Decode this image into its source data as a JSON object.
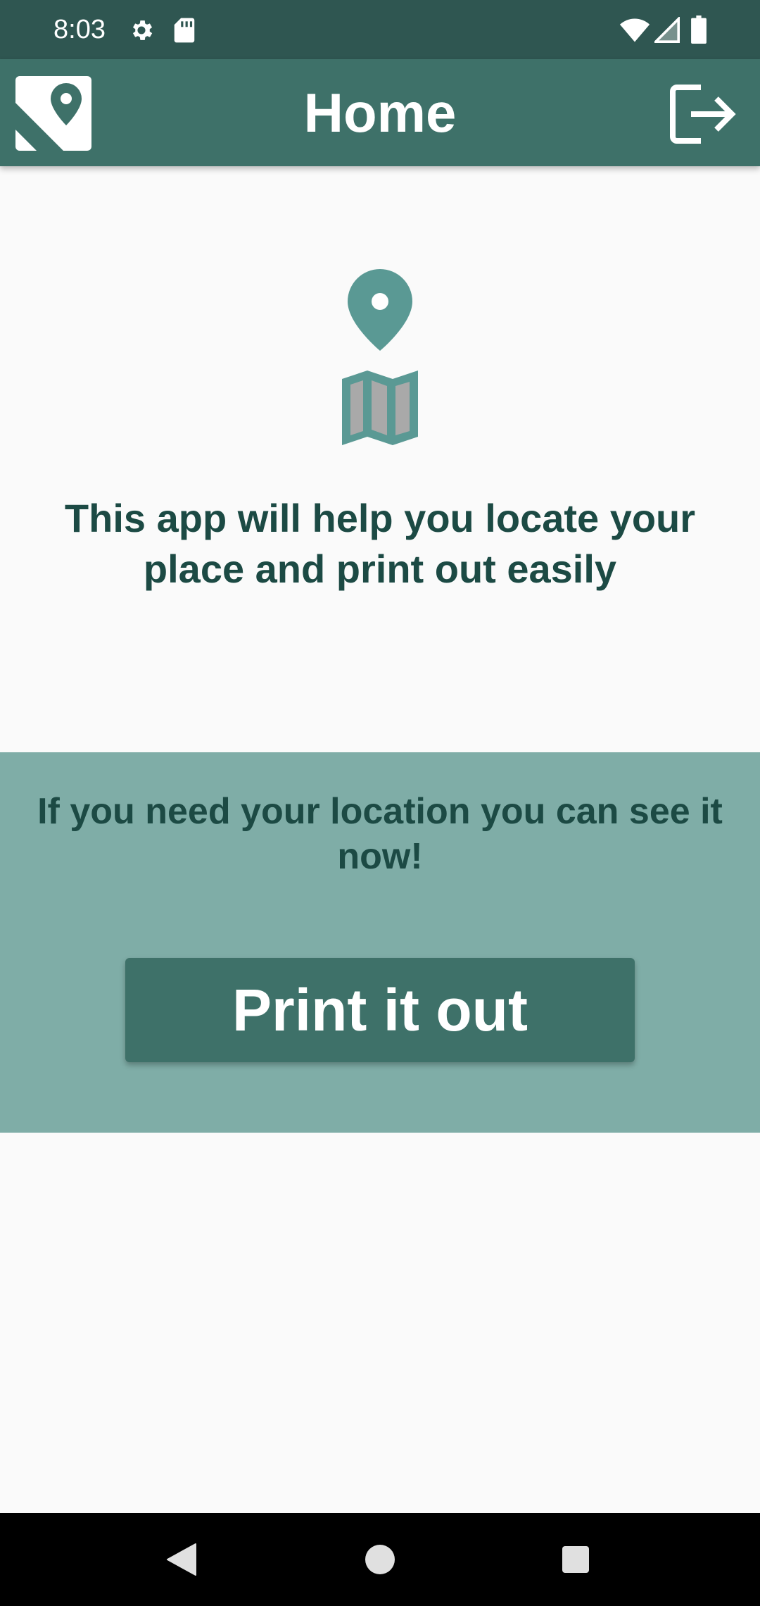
{
  "status_bar": {
    "time": "8:03",
    "icons": [
      "gear-icon",
      "sd-card-icon",
      "wifi-icon",
      "signal-icon",
      "battery-icon"
    ]
  },
  "app_bar": {
    "title": "Home",
    "logo_icon": "map-pin-logo-icon",
    "logout_icon": "logout-icon"
  },
  "hero": {
    "icons": [
      "location-pin-icon",
      "folded-map-icon"
    ],
    "text": "This app will help you locate your place and print out easily"
  },
  "cta": {
    "text": "If you need your location you can see it now!",
    "button_label": "Print it out"
  },
  "nav_bar": {
    "icons": [
      "back-icon",
      "home-icon",
      "recents-icon"
    ]
  },
  "colors": {
    "status_bar": "#2f5651",
    "app_bar": "#3e7169",
    "panel": "#7fada7",
    "text_dark": "#1c4a44",
    "icon_teal": "#5a9994",
    "background": "#fafafa"
  }
}
